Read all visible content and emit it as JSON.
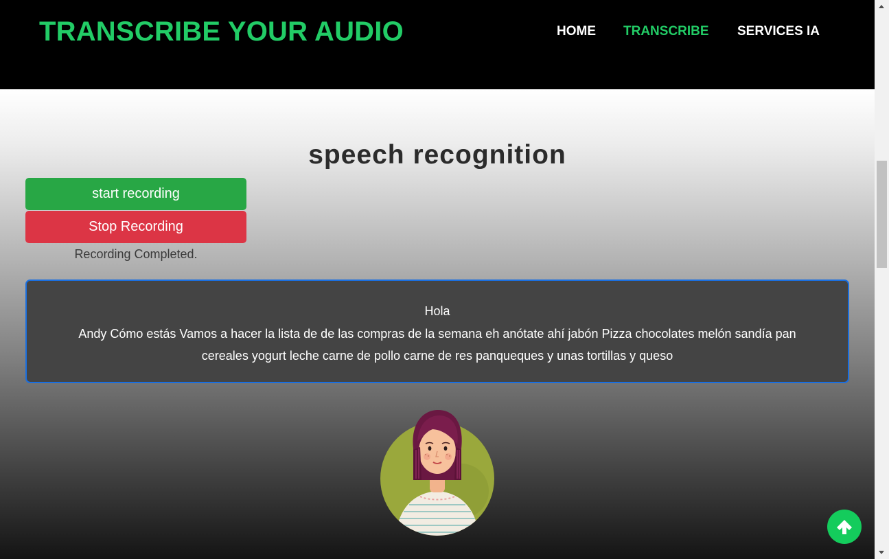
{
  "navbar": {
    "brand": "TRANSCRIBE YOUR AUDIO",
    "links": [
      {
        "label": "HOME",
        "active": false
      },
      {
        "label": "TRANSCRIBE",
        "active": true
      },
      {
        "label": "SERVICES IA",
        "active": false
      }
    ]
  },
  "main": {
    "title": "speech recognition",
    "start_button": "start recording",
    "stop_button": "Stop Recording",
    "status": "Recording Completed.",
    "transcript": {
      "line1": "Hola",
      "line2": "Andy Cómo estás Vamos a hacer la lista de de las compras de la semana eh anótate ahí jabón Pizza chocolates melón sandía pan cereales yogurt leche carne de pollo carne de res panqueques y unas tortillas y queso"
    }
  },
  "icons": {
    "avatar": "woman-avatar-illustration",
    "scroll_top": "arrow-up-icon"
  },
  "colors": {
    "accent_green": "#22cc66",
    "start_green": "#28a745",
    "stop_red": "#dc3545",
    "transcript_border": "#1a6fe0",
    "scroll_top_bg": "#14cc5c"
  }
}
